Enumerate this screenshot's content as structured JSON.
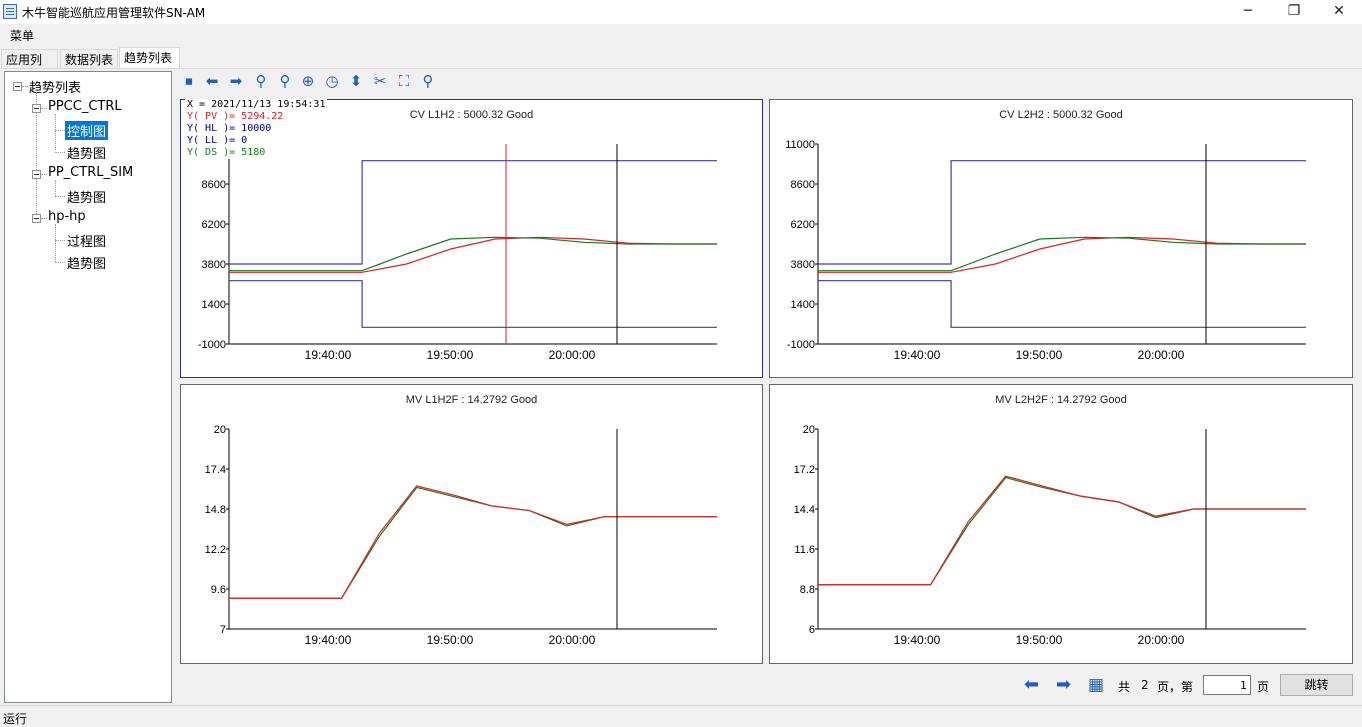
{
  "window": {
    "title": "木牛智能巡航应用管理软件SN-AM",
    "minimize": "─",
    "restore": "❐",
    "close": "✕"
  },
  "menu": {
    "label": "菜单"
  },
  "tabs": [
    {
      "label": "应用列表",
      "active": false
    },
    {
      "label": "数据列表",
      "active": false
    },
    {
      "label": "趋势列表",
      "active": true
    }
  ],
  "tree": {
    "root": "趋势列表",
    "groups": [
      {
        "label": "PPCC_CTRL",
        "children": [
          "控制图",
          "趋势图"
        ]
      },
      {
        "label": "PP_CTRL_SIM",
        "children": [
          "趋势图"
        ]
      },
      {
        "label": "hp-hp",
        "children": [
          "过程图",
          "趋势图"
        ]
      }
    ],
    "selected": "控制图"
  },
  "toolbar": {
    "icons": [
      "stop-icon",
      "back-arrow-icon",
      "forward-arrow-icon",
      "zoom-in-icon",
      "zoom-out-icon",
      "crosshair-icon",
      "clock-icon",
      "scale-vertical-icon",
      "tools-icon",
      "fit-icon",
      "zoom-reset-icon"
    ]
  },
  "cursor_readout": {
    "x_line": "X = 2021/11/13 19:54:31",
    "pv_line": "Y( PV )= 5294.22",
    "hl_line": "Y( HL )= 10000",
    "ll_line": "Y( LL )= 0",
    "ds_line": "Y( DS )= 5180"
  },
  "colors": {
    "limits": "#3c3caa",
    "pv": "#dd2222",
    "setpoint": "#1a7a1a",
    "cursor_red": "#dd2222",
    "marker": "#000000",
    "accent": "#0078d7"
  },
  "panels": [
    {
      "title": "CV L1H2 : 5000.32 Good",
      "focused": true
    },
    {
      "title": "CV L2H2 : 5000.32 Good",
      "focused": false
    },
    {
      "title": "MV L1H2F : 14.2792 Good",
      "focused": false
    },
    {
      "title": "MV L2H2F : 14.2792 Good",
      "focused": false
    }
  ],
  "chart_data": [
    {
      "type": "line",
      "title": "CV L1H2 : 5000.32 Good",
      "x_ticks": [
        "19:40:00",
        "19:50:00",
        "20:00:00"
      ],
      "y_ticks": [
        -1000,
        1400,
        3800,
        6200,
        8600,
        11000
      ],
      "ylim": [
        -1000,
        11000
      ],
      "series": [
        {
          "name": "HL",
          "values": [
            3800,
            3800,
            3800,
            10000,
            10000,
            10000,
            10000,
            10000,
            10000,
            10000,
            10000,
            10000
          ]
        },
        {
          "name": "LL",
          "values": [
            2800,
            2800,
            2800,
            0,
            0,
            0,
            0,
            0,
            0,
            0,
            0,
            0
          ]
        },
        {
          "name": "PV",
          "values": [
            3300,
            3300,
            3300,
            3300,
            3800,
            4700,
            5300,
            5400,
            5300,
            5050,
            5000,
            5000
          ]
        },
        {
          "name": "DS",
          "values": [
            3400,
            3400,
            3400,
            3400,
            4400,
            5300,
            5400,
            5350,
            5100,
            5000,
            5000,
            5000
          ]
        }
      ]
    },
    {
      "type": "line",
      "title": "CV L2H2 : 5000.32 Good",
      "x_ticks": [
        "19:40:00",
        "19:50:00",
        "20:00:00"
      ],
      "y_ticks": [
        -1000,
        1400,
        3800,
        6200,
        8600,
        11000
      ],
      "ylim": [
        -1000,
        11000
      ],
      "series": [
        {
          "values": [
            3800,
            3800,
            3800,
            10000,
            10000,
            10000,
            10000,
            10000,
            10000,
            10000,
            10000,
            10000
          ]
        },
        {
          "values": [
            2800,
            2800,
            2800,
            0,
            0,
            0,
            0,
            0,
            0,
            0,
            0,
            0
          ]
        },
        {
          "values": [
            3300,
            3300,
            3300,
            3300,
            3800,
            4700,
            5300,
            5400,
            5300,
            5050,
            5000,
            5000
          ]
        },
        {
          "values": [
            3400,
            3400,
            3400,
            3400,
            4400,
            5300,
            5400,
            5350,
            5100,
            5000,
            5000,
            5000
          ]
        }
      ]
    },
    {
      "type": "line",
      "title": "MV L1H2F : 14.2792 Good",
      "x_ticks": [
        "19:40:00",
        "19:50:00",
        "20:00:00"
      ],
      "y_ticks": [
        7,
        9.6,
        12.2,
        14.8,
        17.4,
        20
      ],
      "ylim": [
        7,
        20
      ],
      "series": [
        {
          "values": [
            9.0,
            9.0,
            9.0,
            9.0,
            13.0,
            16.2,
            15.6,
            15.0,
            14.7,
            13.7,
            14.3,
            14.3,
            14.3,
            14.3
          ]
        },
        {
          "values": [
            9.0,
            9.0,
            9.0,
            9.0,
            13.2,
            16.3,
            15.7,
            15.0,
            14.7,
            13.8,
            14.3,
            14.3,
            14.3,
            14.3
          ]
        }
      ]
    },
    {
      "type": "line",
      "title": "MV L2H2F : 14.2792 Good",
      "x_ticks": [
        "19:40:00",
        "19:50:00",
        "20:00:00"
      ],
      "y_ticks": [
        6,
        8.8,
        11.6,
        14.4,
        17.2,
        20
      ],
      "ylim": [
        6,
        20
      ],
      "series": [
        {
          "values": [
            9.1,
            9.1,
            9.1,
            9.1,
            13.3,
            16.6,
            15.9,
            15.3,
            14.9,
            13.8,
            14.4,
            14.4,
            14.4,
            14.4
          ]
        },
        {
          "values": [
            9.1,
            9.1,
            9.1,
            9.1,
            13.5,
            16.7,
            16.0,
            15.3,
            14.9,
            13.9,
            14.4,
            14.4,
            14.4,
            14.4
          ]
        }
      ]
    }
  ],
  "pager": {
    "total_prefix": "共",
    "total_pages": "2",
    "page_suffix": "页，第",
    "current_page": "1",
    "page_unit": "页",
    "jump_label": "跳转"
  },
  "status": {
    "text": "运行"
  }
}
